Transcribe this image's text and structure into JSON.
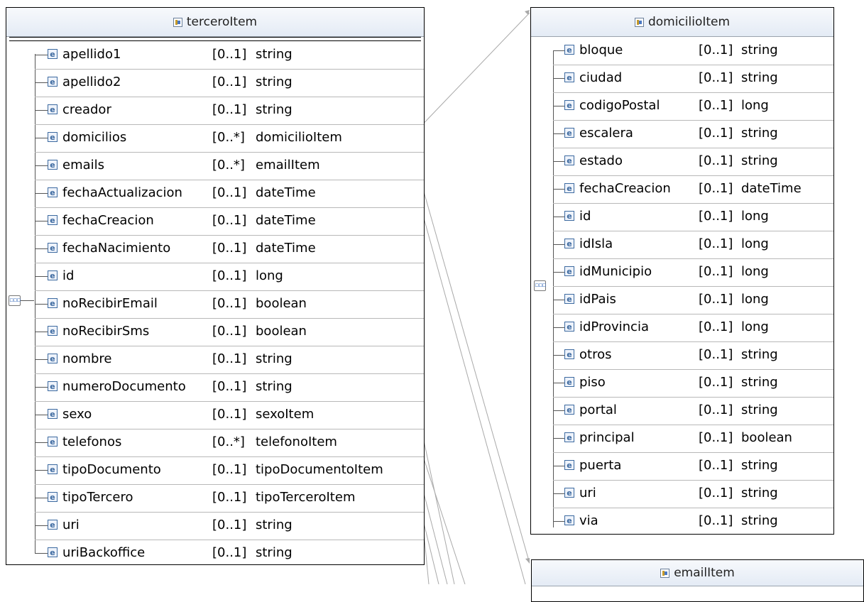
{
  "tercero": {
    "title": "terceroItem",
    "rows": [
      {
        "name": "apellido1",
        "mult": "[0..1]",
        "type": "string"
      },
      {
        "name": "apellido2",
        "mult": "[0..1]",
        "type": "string"
      },
      {
        "name": "creador",
        "mult": "[0..1]",
        "type": "string"
      },
      {
        "name": "domicilios",
        "mult": "[0..*]",
        "type": "domicilioItem"
      },
      {
        "name": "emails",
        "mult": "[0..*]",
        "type": "emailItem"
      },
      {
        "name": "fechaActualizacion",
        "mult": "[0..1]",
        "type": "dateTime"
      },
      {
        "name": "fechaCreacion",
        "mult": "[0..1]",
        "type": "dateTime"
      },
      {
        "name": "fechaNacimiento",
        "mult": "[0..1]",
        "type": "dateTime"
      },
      {
        "name": "id",
        "mult": "[0..1]",
        "type": "long"
      },
      {
        "name": "noRecibirEmail",
        "mult": "[0..1]",
        "type": "boolean"
      },
      {
        "name": "noRecibirSms",
        "mult": "[0..1]",
        "type": "boolean"
      },
      {
        "name": "nombre",
        "mult": "[0..1]",
        "type": "string"
      },
      {
        "name": "numeroDocumento",
        "mult": "[0..1]",
        "type": "string"
      },
      {
        "name": "sexo",
        "mult": "[0..1]",
        "type": "sexoItem"
      },
      {
        "name": "telefonos",
        "mult": "[0..*]",
        "type": "telefonoItem"
      },
      {
        "name": "tipoDocumento",
        "mult": "[0..1]",
        "type": "tipoDocumentoItem"
      },
      {
        "name": "tipoTercero",
        "mult": "[0..1]",
        "type": "tipoTerceroItem"
      },
      {
        "name": "uri",
        "mult": "[0..1]",
        "type": "string"
      },
      {
        "name": "uriBackoffice",
        "mult": "[0..1]",
        "type": "string"
      }
    ]
  },
  "domicilio": {
    "title": "domicilioItem",
    "rows": [
      {
        "name": "bloque",
        "mult": "[0..1]",
        "type": "string"
      },
      {
        "name": "ciudad",
        "mult": "[0..1]",
        "type": "string"
      },
      {
        "name": "codigoPostal",
        "mult": "[0..1]",
        "type": "long"
      },
      {
        "name": "escalera",
        "mult": "[0..1]",
        "type": "string"
      },
      {
        "name": "estado",
        "mult": "[0..1]",
        "type": "string"
      },
      {
        "name": "fechaCreacion",
        "mult": "[0..1]",
        "type": "dateTime"
      },
      {
        "name": "id",
        "mult": "[0..1]",
        "type": "long"
      },
      {
        "name": "idIsla",
        "mult": "[0..1]",
        "type": "long"
      },
      {
        "name": "idMunicipio",
        "mult": "[0..1]",
        "type": "long"
      },
      {
        "name": "idPais",
        "mult": "[0..1]",
        "type": "long"
      },
      {
        "name": "idProvincia",
        "mult": "[0..1]",
        "type": "long"
      },
      {
        "name": "otros",
        "mult": "[0..1]",
        "type": "string"
      },
      {
        "name": "piso",
        "mult": "[0..1]",
        "type": "string"
      },
      {
        "name": "portal",
        "mult": "[0..1]",
        "type": "string"
      },
      {
        "name": "principal",
        "mult": "[0..1]",
        "type": "boolean"
      },
      {
        "name": "puerta",
        "mult": "[0..1]",
        "type": "string"
      },
      {
        "name": "uri",
        "mult": "[0..1]",
        "type": "string"
      },
      {
        "name": "via",
        "mult": "[0..1]",
        "type": "string"
      }
    ]
  },
  "email": {
    "title": "emailItem"
  },
  "element_icon_glyph": "e",
  "sequence_icon_glyph": "▫▫▫"
}
